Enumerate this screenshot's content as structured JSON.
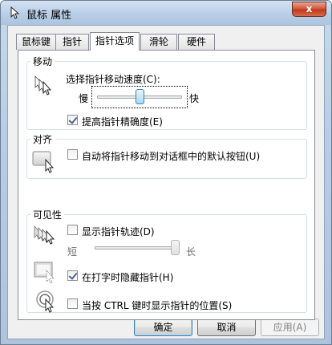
{
  "window": {
    "title": "鼠标 属性",
    "close_glyph": "x"
  },
  "tabs": [
    {
      "label": "鼠标键",
      "active": false
    },
    {
      "label": "指针",
      "active": false
    },
    {
      "label": "指针选项",
      "active": true
    },
    {
      "label": "滑轮",
      "active": false
    },
    {
      "label": "硬件",
      "active": false
    }
  ],
  "motion": {
    "group_label": "移动",
    "speed_label": "选择指针移动速度(C):",
    "slow_label": "慢",
    "fast_label": "快",
    "speed_fraction": 0.5,
    "precision_label": "提高指针精确度(E)",
    "precision_checked": true
  },
  "snap": {
    "group_label": "对齐",
    "snap_label": "自动将指针移动到对话框中的默认按钮(U)",
    "snap_checked": false
  },
  "visibility": {
    "group_label": "可见性",
    "trails_label": "显示指针轨迹(D)",
    "trails_checked": false,
    "short_label": "短",
    "long_label": "长",
    "trails_fraction": 1.0,
    "hide_label": "在打字时隐藏指针(H)",
    "hide_checked": true,
    "ctrl_label": "当按 CTRL 键时显示指针的位置(S)",
    "ctrl_checked": false
  },
  "buttons": {
    "ok": "确定",
    "cancel": "取消",
    "apply": "应用(A)"
  },
  "colors": {
    "accent": "#3c7fb1",
    "close": "#c1371b"
  }
}
